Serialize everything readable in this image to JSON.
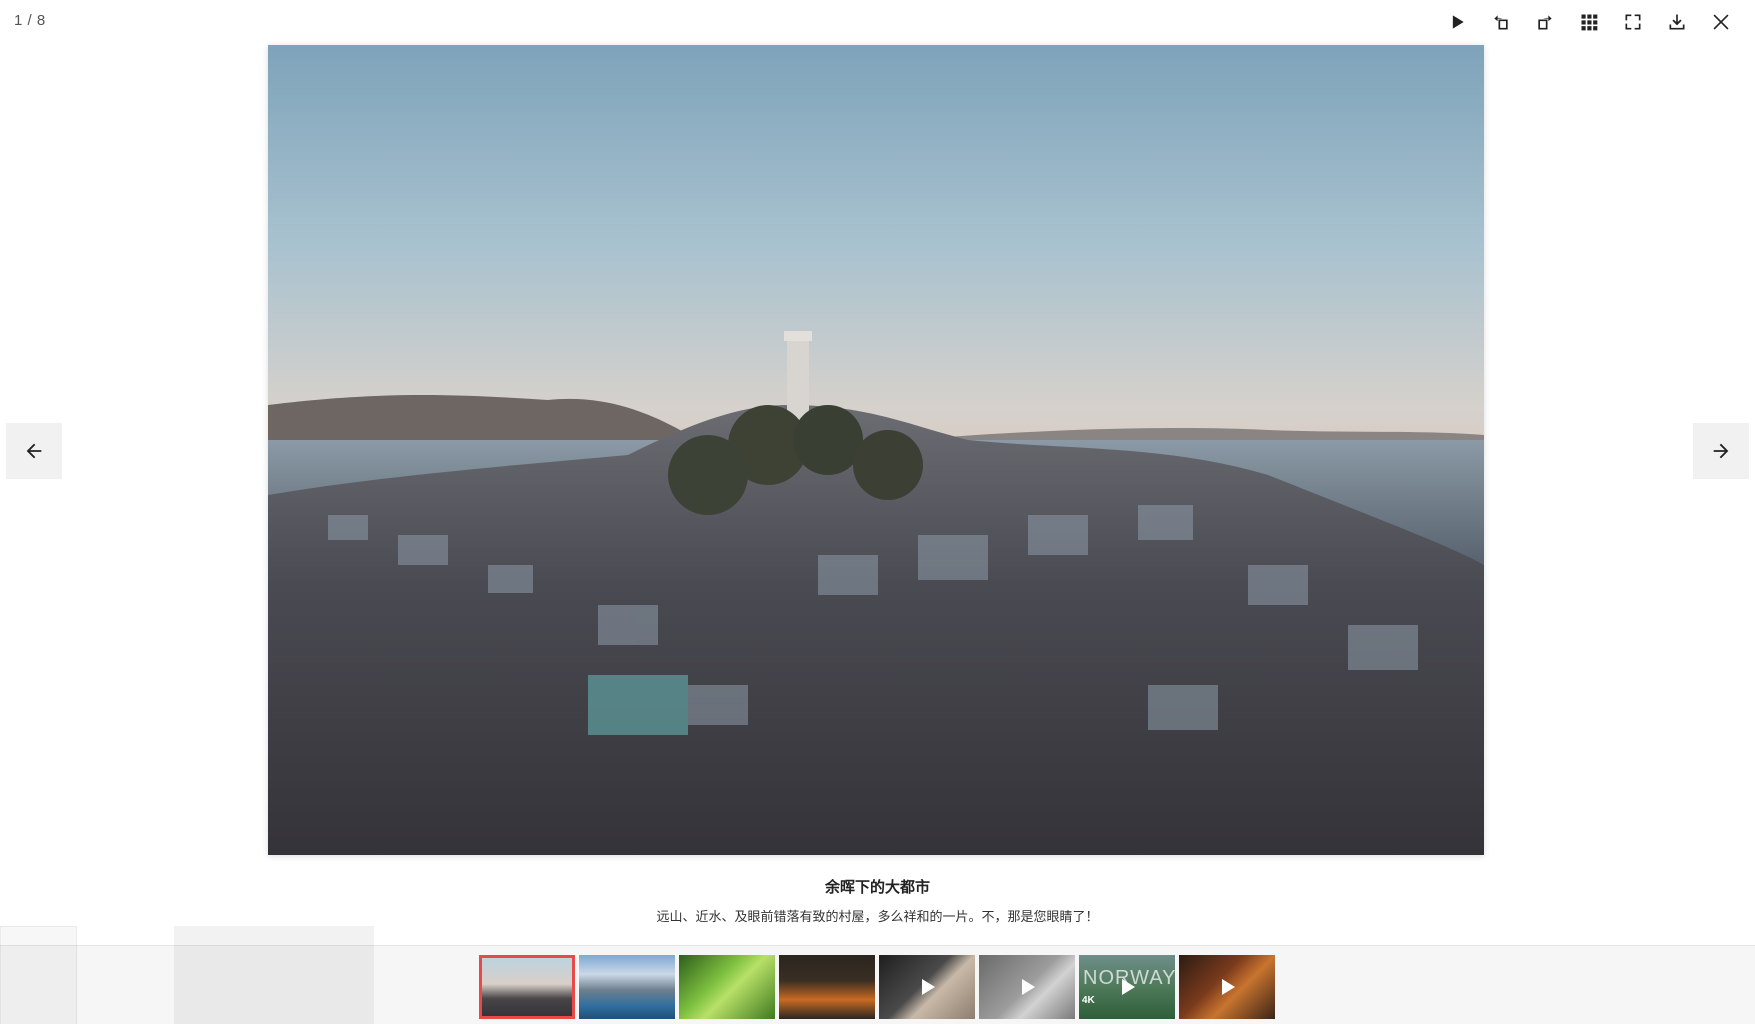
{
  "viewer": {
    "counter": "1 / 8",
    "current_index": 1,
    "total": 8
  },
  "toolbar": {
    "items": [
      {
        "name": "play-icon",
        "label": "slideshow"
      },
      {
        "name": "rotate-left-icon",
        "label": "rotate left"
      },
      {
        "name": "rotate-right-icon",
        "label": "rotate right"
      },
      {
        "name": "grid-icon",
        "label": "thumbnails"
      },
      {
        "name": "fullscreen-icon",
        "label": "fullscreen"
      },
      {
        "name": "download-icon",
        "label": "download"
      },
      {
        "name": "close-icon",
        "label": "close"
      }
    ]
  },
  "caption": {
    "title": "余晖下的大都市",
    "description": "远山、近水、及眼前错落有致的村屋，多么祥和的一片。不，那是您眼睛了！"
  },
  "thumbnails": [
    {
      "kind": "image",
      "active": true
    },
    {
      "kind": "image",
      "active": false
    },
    {
      "kind": "image",
      "active": false
    },
    {
      "kind": "image",
      "active": false
    },
    {
      "kind": "video",
      "active": false
    },
    {
      "kind": "video",
      "active": false
    },
    {
      "kind": "video",
      "active": false,
      "overlay_text": "NORWAY",
      "overlay_sub": "4K"
    },
    {
      "kind": "video",
      "active": false
    }
  ],
  "colors": {
    "active_border": "#e84a4a",
    "icon": "#222222"
  }
}
